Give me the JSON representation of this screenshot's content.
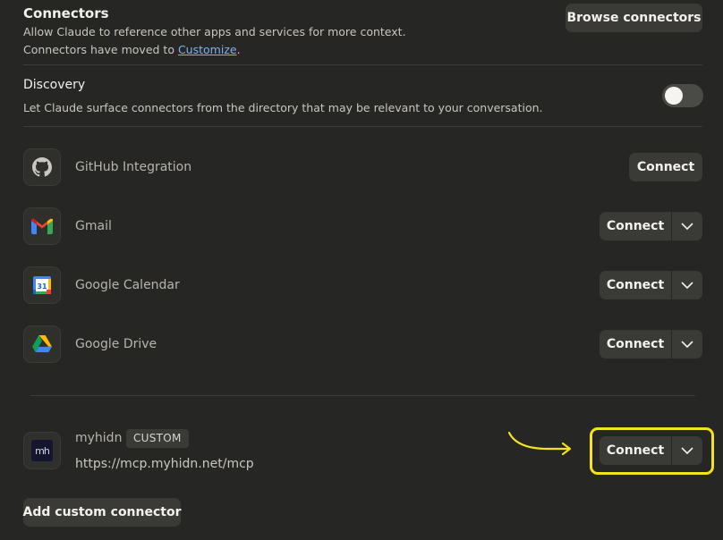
{
  "header": {
    "title": "Connectors",
    "description": "Allow Claude to reference other apps and services for more context.",
    "moved_prefix": "Connectors have moved to ",
    "moved_link": "Customize",
    "moved_suffix": ".",
    "browse_label": "Browse connectors"
  },
  "discovery": {
    "title": "Discovery",
    "description": "Let Claude surface connectors from the directory that may be relevant to your conversation.",
    "enabled": false
  },
  "connectors": [
    {
      "name": "GitHub Integration",
      "icon": "github-icon",
      "button": "Connect"
    },
    {
      "name": "Gmail",
      "icon": "gmail-icon",
      "button": "Connect"
    },
    {
      "name": "Google Calendar",
      "icon": "google-calendar-icon",
      "button": "Connect",
      "calendar_day": "31"
    },
    {
      "name": "Google Drive",
      "icon": "google-drive-icon",
      "button": "Connect"
    }
  ],
  "custom": {
    "name": "myhidn",
    "badge": "CUSTOM",
    "url": "https://mcp.myhidn.net/mcp",
    "button": "Connect",
    "logo_text": "mh"
  },
  "add_custom_label": "Add custom connector",
  "colors": {
    "background": "#262624",
    "button": "#3a3a37",
    "link": "#7fb3ef",
    "highlight": "#f4e21d"
  }
}
